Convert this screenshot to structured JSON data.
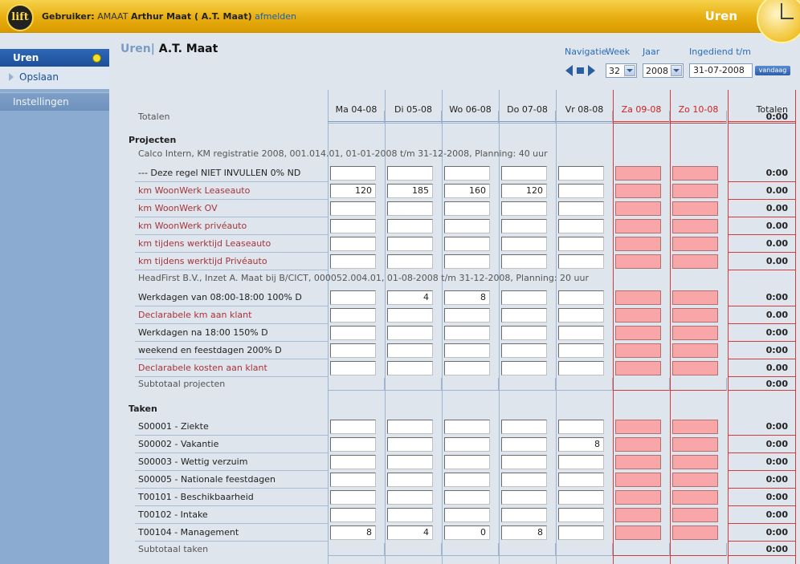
{
  "header": {
    "logo_text": "lift",
    "user_prefix": "Gebruiker:",
    "user_code": "AMAAT",
    "user_name": "Arthur Maat ( A.T. Maat)",
    "logout_label": "afmelden",
    "app_title": "Uren"
  },
  "sidebar": {
    "active": "Uren",
    "sub_item": "Opslaan",
    "other": "Instellingen"
  },
  "main": {
    "crumb": "Uren|",
    "who": "A.T. Maat",
    "nav_label": "Navigatie",
    "week_label": "Week",
    "year_label": "Jaar",
    "submitted_label": "Ingediend t/m",
    "week_value": "32",
    "year_value": "2008",
    "submitted_value": "31-07-2008",
    "today_button": "vandaag"
  },
  "columns": [
    "Ma 04-08",
    "Di 05-08",
    "Wo 06-08",
    "Do 07-08",
    "Vr 08-08",
    "Za 09-08",
    "Zo 10-08"
  ],
  "totals_col": "Totalen",
  "totals_row": {
    "label": "Totalen",
    "value": "0:00"
  },
  "projects": {
    "title": "Projecten",
    "groups": [
      {
        "info": "Calco Intern,   KM registratie 2008,   001.014.01,   01-01-2008 t/m 31-12-2008,   Planning: 40 uur",
        "rows": [
          {
            "label": "--- Deze regel NIET INVULLEN   0% ND",
            "red": false,
            "values": [
              "",
              "",
              "",
              "",
              "",
              "",
              ""
            ],
            "total": "0:00"
          },
          {
            "label": "km WoonWerk Leaseauto",
            "red": true,
            "values": [
              "120",
              "185",
              "160",
              "120",
              "",
              "",
              ""
            ],
            "total": "0.00"
          },
          {
            "label": "km WoonWerk OV",
            "red": true,
            "values": [
              "",
              "",
              "",
              "",
              "",
              "",
              ""
            ],
            "total": "0.00"
          },
          {
            "label": "km WoonWerk privéauto",
            "red": true,
            "values": [
              "",
              "",
              "",
              "",
              "",
              "",
              ""
            ],
            "total": "0.00"
          },
          {
            "label": "km tijdens werktijd Leaseauto",
            "red": true,
            "values": [
              "",
              "",
              "",
              "",
              "",
              "",
              ""
            ],
            "total": "0.00"
          },
          {
            "label": "km tijdens werktijd Privéauto",
            "red": true,
            "values": [
              "",
              "",
              "",
              "",
              "",
              "",
              ""
            ],
            "total": "0.00"
          }
        ]
      },
      {
        "info": "HeadFirst B.V.,   Inzet A. Maat bij B/CICT,   000052.004.01,   01-08-2008 t/m 31-12-2008,   Planning: 20 uur",
        "rows": [
          {
            "label": "Werkdagen van 08:00-18:00     100% D",
            "red": false,
            "values": [
              "",
              "4",
              "8",
              "",
              "",
              "",
              ""
            ],
            "total": "0:00"
          },
          {
            "label": "Declarabele km aan klant",
            "red": true,
            "values": [
              "",
              "",
              "",
              "",
              "",
              "",
              ""
            ],
            "total": "0.00"
          },
          {
            "label": "Werkdagen na 18:00               150% D",
            "red": false,
            "values": [
              "",
              "",
              "",
              "",
              "",
              "",
              ""
            ],
            "total": "0:00"
          },
          {
            "label": "weekend en feestdagen            200% D",
            "red": false,
            "values": [
              "",
              "",
              "",
              "",
              "",
              "",
              ""
            ],
            "total": "0:00"
          },
          {
            "label": "Declarabele kosten aan klant",
            "red": true,
            "values": [
              "",
              "",
              "",
              "",
              "",
              "",
              ""
            ],
            "total": "0.00"
          }
        ]
      }
    ],
    "subtotal_label": "Subtotaal projecten",
    "subtotal_value": "0:00"
  },
  "tasks": {
    "title": "Taken",
    "rows": [
      {
        "label": "S00001 - Ziekte",
        "values": [
          "",
          "",
          "",
          "",
          "",
          "",
          ""
        ],
        "total": "0:00"
      },
      {
        "label": "S00002 - Vakantie",
        "values": [
          "",
          "",
          "",
          "",
          "8",
          "",
          ""
        ],
        "total": "0:00"
      },
      {
        "label": "S00003 - Wettig verzuim",
        "values": [
          "",
          "",
          "",
          "",
          "",
          "",
          ""
        ],
        "total": "0:00"
      },
      {
        "label": "S00005 - Nationale feestdagen",
        "values": [
          "",
          "",
          "",
          "",
          "",
          "",
          ""
        ],
        "total": "0:00"
      },
      {
        "label": "T00101 - Beschikbaarheid",
        "values": [
          "",
          "",
          "",
          "",
          "",
          "",
          ""
        ],
        "total": "0:00"
      },
      {
        "label": "T00102 - Intake",
        "values": [
          "",
          "",
          "",
          "",
          "",
          "",
          ""
        ],
        "total": "0:00"
      },
      {
        "label": "T00104 - Management",
        "values": [
          "8",
          "4",
          "0",
          "8",
          "",
          "",
          ""
        ],
        "total": "0:00"
      }
    ],
    "subtotal_label": "Subtotaal taken",
    "subtotal_value": "0:00"
  },
  "colors": {
    "weekend_header": "#cc2222",
    "weekend_cell": "#f8a6a8",
    "header_gold": "#e8ae10"
  }
}
